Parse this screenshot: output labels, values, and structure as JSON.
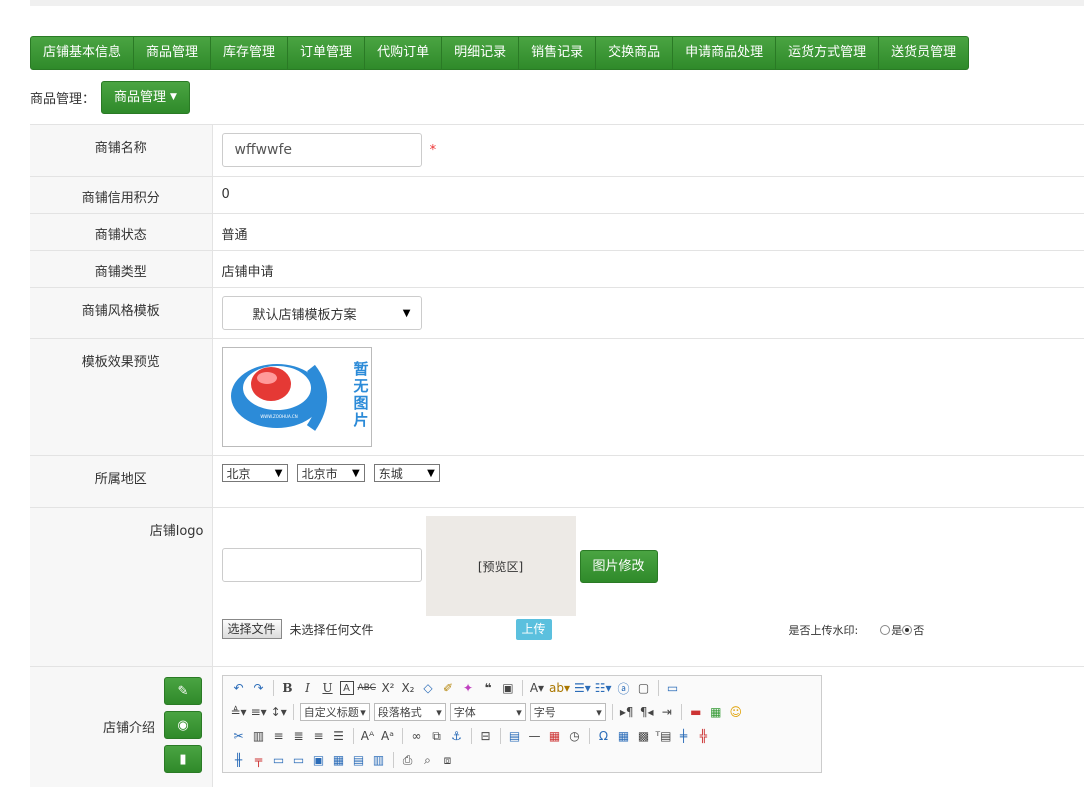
{
  "nav": [
    "店铺基本信息",
    "商品管理",
    "库存管理",
    "订单管理",
    "代购订单",
    "明细记录",
    "销售记录",
    "交换商品",
    "申请商品处理",
    "运货方式管理",
    "送货员管理"
  ],
  "breadcrumb": {
    "label": "商品管理：",
    "dropdown": "商品管理"
  },
  "form": {
    "shop_name": {
      "label": "商铺名称",
      "value": "wffwwfe",
      "required_mark": "*"
    },
    "credit": {
      "label": "商铺信用积分",
      "value": "0"
    },
    "status": {
      "label": "商铺状态",
      "value": "普通"
    },
    "type": {
      "label": "商铺类型",
      "value": "店铺申请"
    },
    "template": {
      "label": "商铺风格模板",
      "value": "默认店铺模板方案"
    },
    "preview": {
      "label": "模板效果预览",
      "image_text": "暂无图片",
      "image_caption": "WWW.ZOOHUA.CN"
    },
    "region": {
      "label": "所属地区",
      "province": "北京",
      "city": "北京市",
      "district": "东城"
    },
    "logo": {
      "label": "店铺logo",
      "preview_text": "[预览区]",
      "change_button": "图片修改",
      "file_button": "选择文件",
      "file_status": "未选择任何文件",
      "upload_button": "上传",
      "watermark_label": "是否上传水印:",
      "watermark_yes": "是",
      "watermark_no": "否",
      "watermark_selected": "否"
    },
    "intro": {
      "label": "店铺介绍",
      "combo_title": "自定义标题",
      "combo_para": "段落格式",
      "combo_font": "字体",
      "combo_size": "字号"
    }
  },
  "colors": {
    "nav_green": "#3c9836",
    "upload_blue": "#5bc0de",
    "required_red": "#ee3333"
  }
}
